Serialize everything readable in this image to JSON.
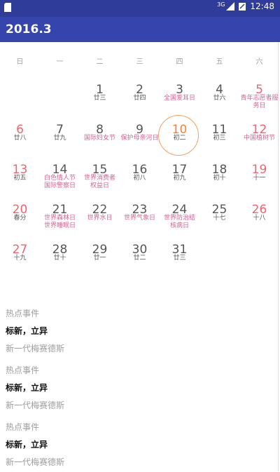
{
  "status_bar": {
    "network": "3G",
    "time": "12:48"
  },
  "app_bar": {
    "title": "2016.3"
  },
  "weekdays": [
    "日",
    "一",
    "二",
    "三",
    "四",
    "五",
    "六"
  ],
  "calendar": {
    "first_weekday_index": 2,
    "selected_day": 10,
    "days": [
      {
        "day": "1",
        "sub": "廿三",
        "festival": false
      },
      {
        "day": "2",
        "sub": "廿四",
        "festival": false
      },
      {
        "day": "3",
        "sub": "全国爱耳日",
        "festival": true
      },
      {
        "day": "4",
        "sub": "廿六",
        "festival": false
      },
      {
        "day": "5",
        "sub": "青年志愿者服务日",
        "festival": true
      },
      {
        "day": "6",
        "sub": "廿八",
        "festival": false
      },
      {
        "day": "7",
        "sub": "廿九",
        "festival": false
      },
      {
        "day": "8",
        "sub": "国际妇女节",
        "festival": true
      },
      {
        "day": "9",
        "sub": "保护母亲河日",
        "festival": true
      },
      {
        "day": "10",
        "sub": "初二",
        "festival": false
      },
      {
        "day": "11",
        "sub": "初三",
        "festival": false
      },
      {
        "day": "12",
        "sub": "中国植树节",
        "festival": true
      },
      {
        "day": "13",
        "sub": "初五",
        "festival": false
      },
      {
        "day": "14",
        "sub": "白色情人节\n国际警察日",
        "festival": true
      },
      {
        "day": "15",
        "sub": "世界消费者\n权益日",
        "festival": true
      },
      {
        "day": "16",
        "sub": "初八",
        "festival": false
      },
      {
        "day": "17",
        "sub": "初九",
        "festival": false
      },
      {
        "day": "18",
        "sub": "初十",
        "festival": false
      },
      {
        "day": "19",
        "sub": "十一",
        "festival": false
      },
      {
        "day": "20",
        "sub": "春分",
        "festival": false
      },
      {
        "day": "21",
        "sub": "世界森林日\n世界睡眠日",
        "festival": true
      },
      {
        "day": "22",
        "sub": "世界水日",
        "festival": true
      },
      {
        "day": "23",
        "sub": "世界气象日",
        "festival": true
      },
      {
        "day": "24",
        "sub": "世界防治结\n核病日",
        "festival": true
      },
      {
        "day": "25",
        "sub": "十七",
        "festival": false
      },
      {
        "day": "26",
        "sub": "十八",
        "festival": false
      },
      {
        "day": "27",
        "sub": "十九",
        "festival": false
      },
      {
        "day": "28",
        "sub": "廿十",
        "festival": false
      },
      {
        "day": "29",
        "sub": "廿一",
        "festival": false
      },
      {
        "day": "30",
        "sub": "廿二",
        "festival": false
      },
      {
        "day": "31",
        "sub": "廿三",
        "festival": false
      }
    ]
  },
  "events": [
    {
      "header": "热点事件",
      "title": "标新，立异",
      "desc": "新一代梅赛德斯"
    },
    {
      "header": "热点事件",
      "title": "标新，立异",
      "desc": "新一代梅赛德斯"
    },
    {
      "header": "热点事件",
      "title": "标新，立异",
      "desc": "新一代梅赛德斯"
    }
  ],
  "colors": {
    "primary": "#3644ae",
    "status": "#2f3c99",
    "weekend": "#f1636f",
    "festival": "#d66393",
    "selected": "#f5813c"
  }
}
